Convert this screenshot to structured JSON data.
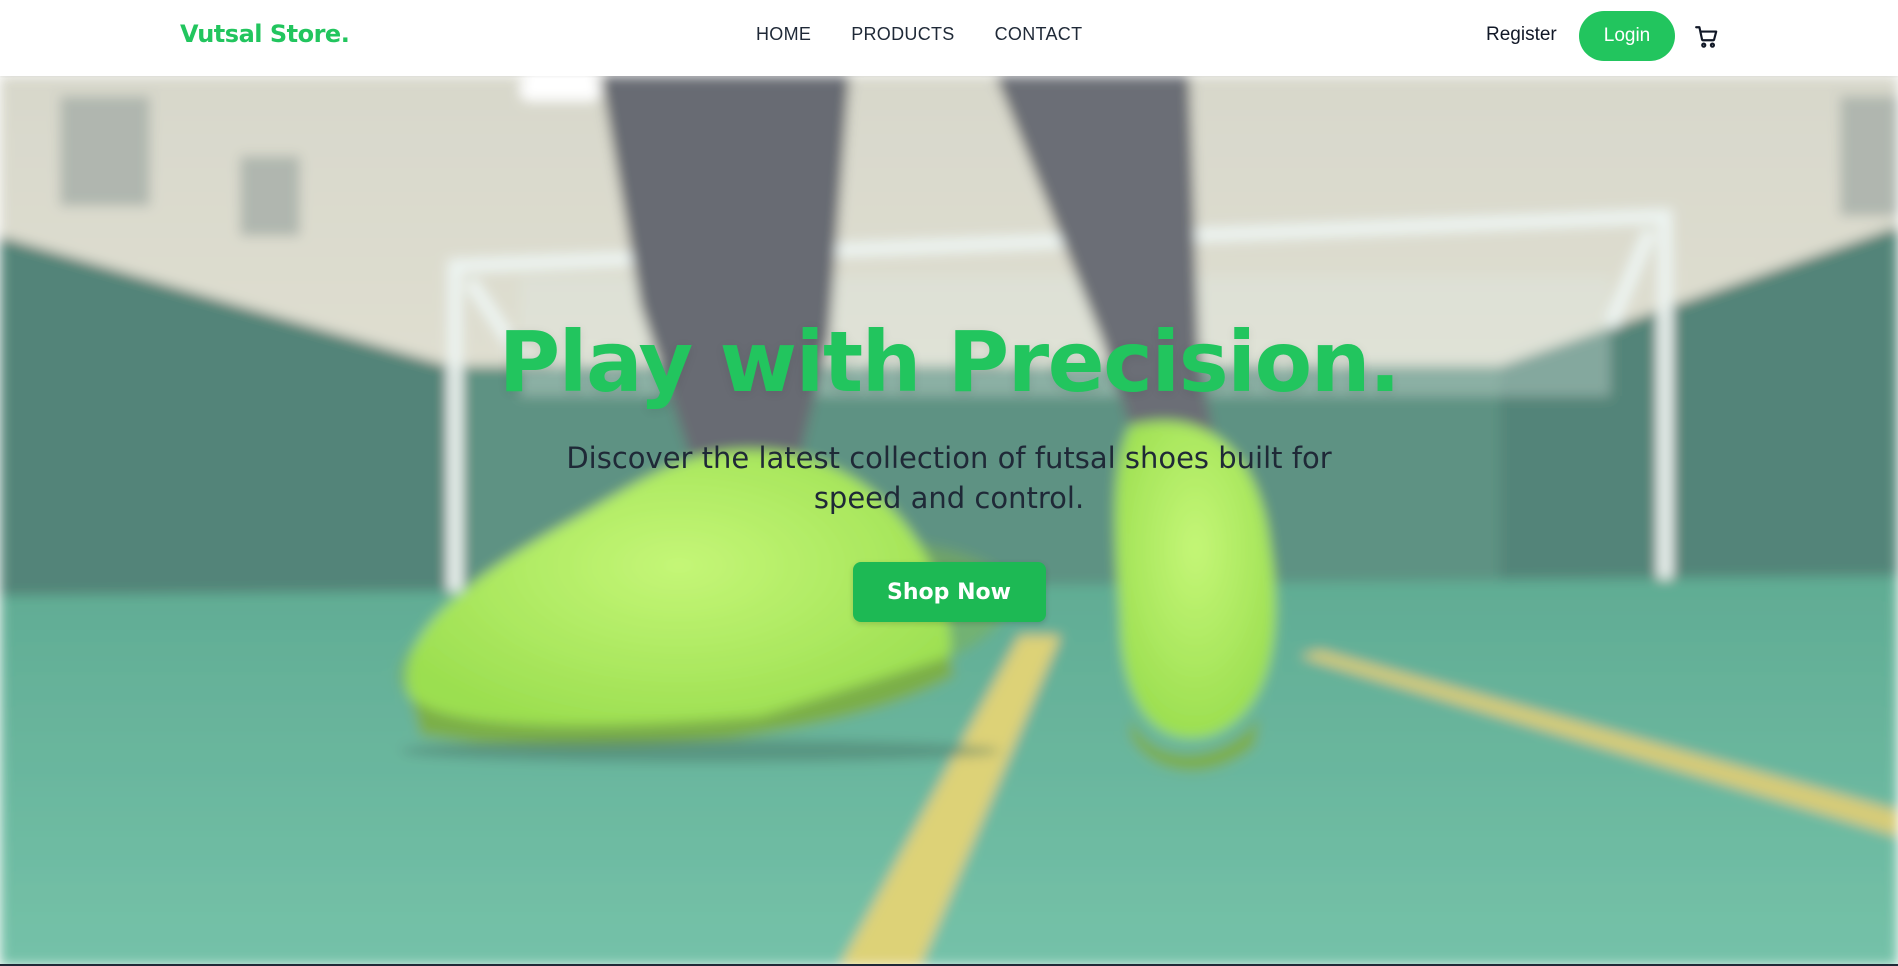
{
  "brand": {
    "name": "Vutsal Store.",
    "color": "#22c55e"
  },
  "nav": {
    "links": [
      {
        "label": "HOME"
      },
      {
        "label": "PRODUCTS"
      },
      {
        "label": "CONTACT"
      }
    ],
    "register_label": "Register",
    "login_label": "Login",
    "cart_icon": "shopping-cart-icon"
  },
  "hero": {
    "title": "Play with Precision.",
    "subtitle": "Discover the latest collection of futsal shoes built for speed and control.",
    "cta_label": "Shop Now",
    "background_image": "blurred photo of lime-green futsal shoes on a teal indoor court with a goal in the background"
  },
  "colors": {
    "accent": "#22c55e",
    "button": "#1db954",
    "court": "#3fa986",
    "wall_dark": "#2f6b5c",
    "wall_light": "#e7e4d2",
    "shoe": "#a6f03a"
  }
}
